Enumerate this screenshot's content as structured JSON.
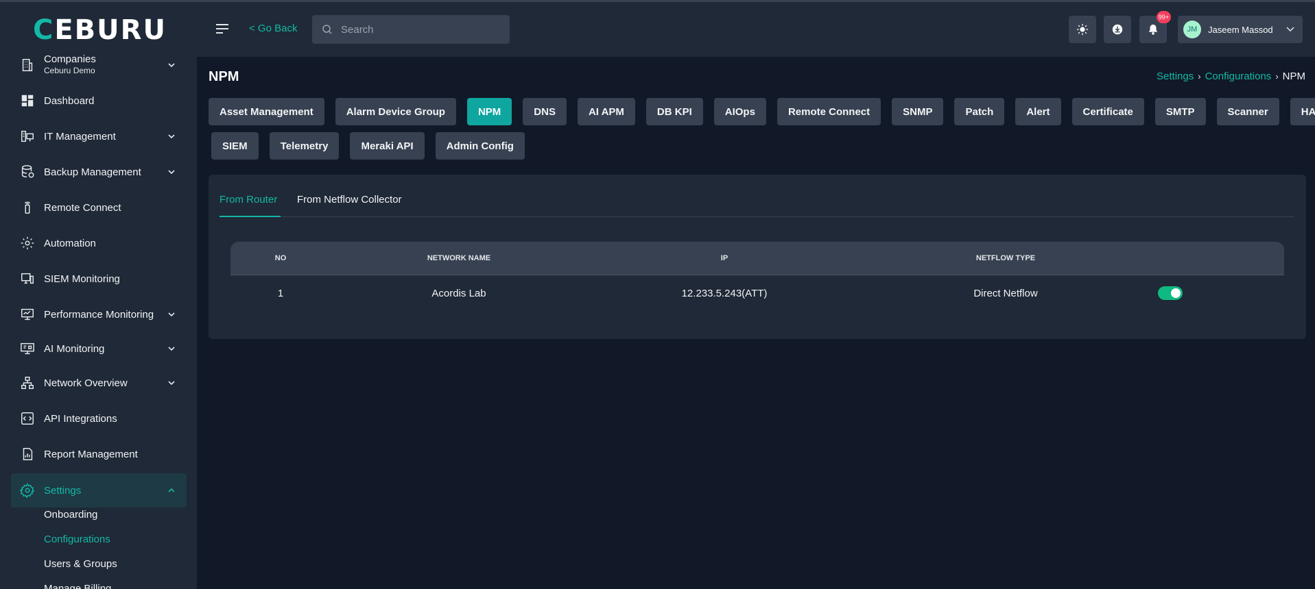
{
  "app": {
    "logo": "CEBURU"
  },
  "header": {
    "go_back": "< Go Back",
    "search_placeholder": "Search",
    "notification_badge": "99+",
    "user": {
      "initials": "JM",
      "name": "Jaseem Massod"
    }
  },
  "sidebar": {
    "company": {
      "label": "Companies",
      "sub": "Ceburu Demo"
    },
    "items": [
      {
        "label": "Dashboard",
        "icon": "dashboard-icon"
      },
      {
        "label": "IT Management",
        "icon": "it-management-icon"
      },
      {
        "label": "Backup Management",
        "icon": "database-icon"
      },
      {
        "label": "Remote Connect",
        "icon": "remote-icon"
      },
      {
        "label": "Automation",
        "icon": "automation-gear-icon"
      },
      {
        "label": "SIEM Monitoring",
        "icon": "siem-icon"
      },
      {
        "label": "Performance Monitoring",
        "icon": "monitor-chart-icon"
      },
      {
        "label": "AI Monitoring",
        "icon": "ai-monitor-icon"
      },
      {
        "label": "Network Overview",
        "icon": "network-icon"
      },
      {
        "label": "API Integrations",
        "icon": "api-icon"
      },
      {
        "label": "Report Management",
        "icon": "report-icon"
      },
      {
        "label": "Settings",
        "icon": "settings-gear-icon"
      }
    ],
    "settings_sub": [
      "Onboarding",
      "Configurations",
      "Users & Groups",
      "Manage Billing"
    ]
  },
  "page": {
    "title": "NPM",
    "breadcrumb": [
      "Settings",
      "Configurations",
      "NPM"
    ]
  },
  "config_tabs": {
    "row1": [
      "Asset Management",
      "Alarm Device Group",
      "NPM",
      "DNS",
      "AI APM",
      "DB KPI",
      "AIOps",
      "Remote Connect",
      "SNMP",
      "Patch",
      "Alert",
      "Certificate",
      "SMTP",
      "Scanner",
      "HA"
    ],
    "row2": [
      "SIEM",
      "Telemetry",
      "Meraki API",
      "Admin Config"
    ],
    "active": "NPM"
  },
  "sub_tabs": [
    "From Router",
    "From Netflow Collector"
  ],
  "table": {
    "columns": [
      "NO",
      "NETWORK NAME",
      "IP",
      "NETFLOW TYPE"
    ],
    "rows": [
      {
        "no": "1",
        "network_name": "Acordis Lab",
        "ip": "12.233.5.243(ATT)",
        "netflow_type": "Direct Netflow",
        "enabled": true
      }
    ]
  },
  "colors": {
    "accent": "#14b8a6",
    "background": "#111827",
    "panel": "#1f2937",
    "toggle_on": "#10b981"
  }
}
